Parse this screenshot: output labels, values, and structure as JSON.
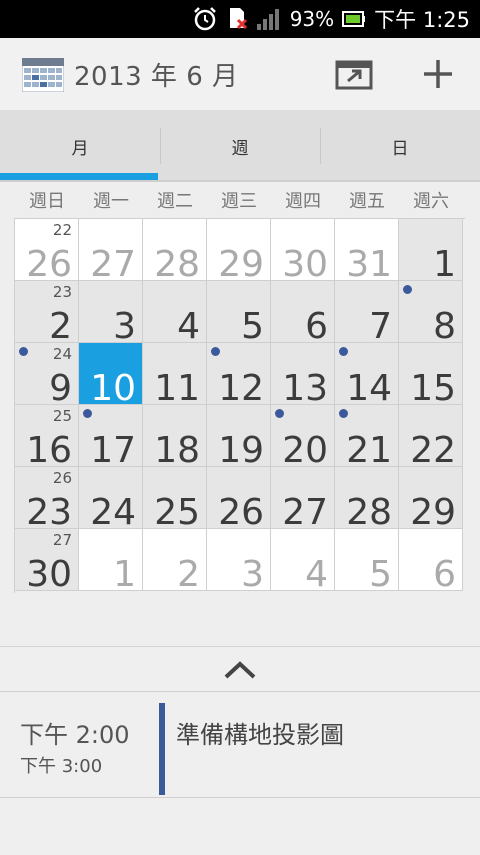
{
  "status_bar": {
    "battery_percent": "93%",
    "time": "下午 1:25",
    "icons": [
      "alarm-clock-icon",
      "sim-error-icon",
      "signal-bars-icon",
      "battery-icon"
    ]
  },
  "app_bar": {
    "title": "2013 年 6 月",
    "icons": [
      "calendar-app-icon",
      "go-to-today-icon",
      "add-event-icon"
    ]
  },
  "tabs": [
    {
      "label": "月",
      "active": true
    },
    {
      "label": "週",
      "active": false
    },
    {
      "label": "日",
      "active": false
    }
  ],
  "weekdays": [
    "週日",
    "週一",
    "週二",
    "週三",
    "週四",
    "週五",
    "週六"
  ],
  "weeks": [
    {
      "week_num": "22",
      "days": [
        "26",
        "27",
        "28",
        "29",
        "30",
        "31",
        "1"
      ]
    },
    {
      "week_num": "23",
      "days": [
        "2",
        "3",
        "4",
        "5",
        "6",
        "7",
        "8"
      ]
    },
    {
      "week_num": "24",
      "days": [
        "9",
        "10",
        "11",
        "12",
        "13",
        "14",
        "15"
      ]
    },
    {
      "week_num": "25",
      "days": [
        "16",
        "17",
        "18",
        "19",
        "20",
        "21",
        "22"
      ]
    },
    {
      "week_num": "26",
      "days": [
        "23",
        "24",
        "25",
        "26",
        "27",
        "28",
        "29"
      ]
    },
    {
      "week_num": "27",
      "days": [
        "30",
        "1",
        "2",
        "3",
        "4",
        "5",
        "6"
      ]
    }
  ],
  "selected_day": "10",
  "accent_color": "#1aa0e0",
  "event_dot_color": "#3a5a9c",
  "agenda": {
    "event": {
      "start": "下午 2:00",
      "end": "下午 3:00",
      "title": "準備構地投影圖"
    }
  }
}
